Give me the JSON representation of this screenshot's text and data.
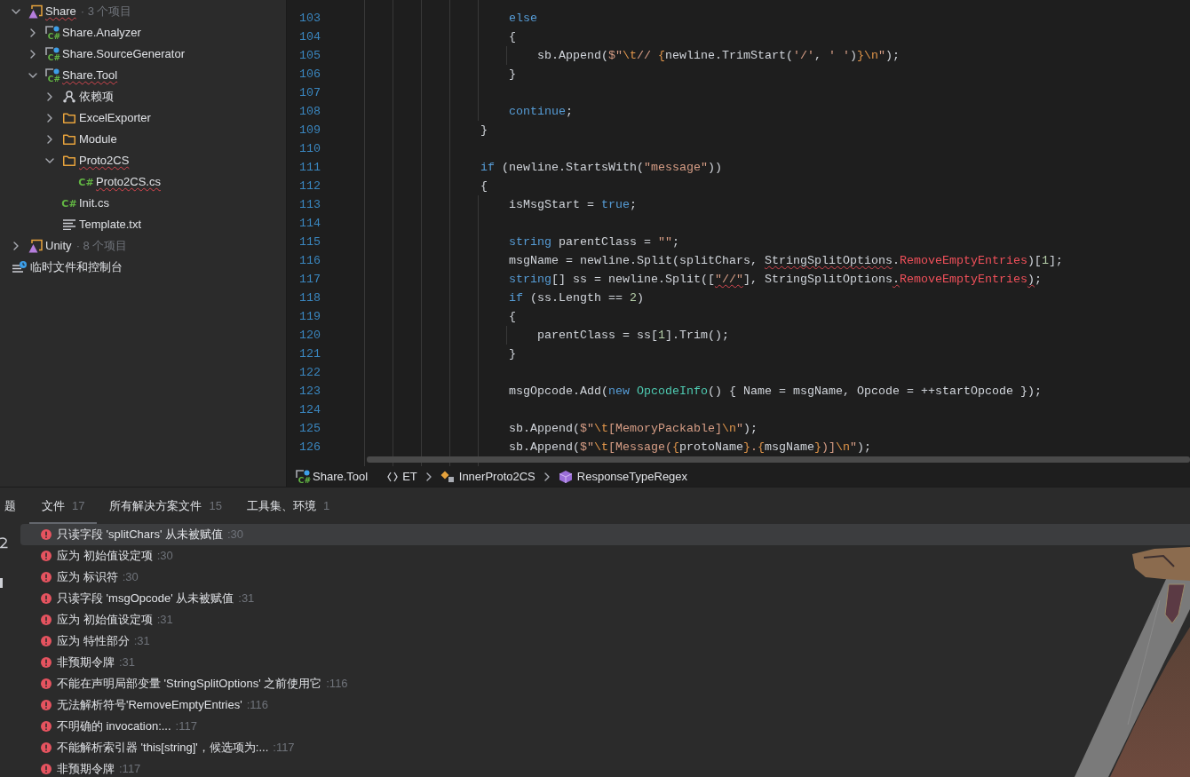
{
  "project_tree": {
    "items": [
      {
        "kind": "solution",
        "label": "Share",
        "suffix": "· 3 个项目",
        "error": true,
        "expanded": true,
        "children": [
          {
            "kind": "csproj",
            "icon_text": "C#",
            "label": "Share.Analyzer",
            "error": false,
            "expanded": false
          },
          {
            "kind": "csproj",
            "icon_text": "C#",
            "label": "Share.SourceGenerator",
            "error": false,
            "expanded": false
          },
          {
            "kind": "csproj",
            "icon_text": "C#",
            "label": "Share.Tool",
            "error": true,
            "expanded": true,
            "children": [
              {
                "kind": "dependencies",
                "label": "依赖项",
                "error": false,
                "expanded": false
              },
              {
                "kind": "folder",
                "label": "ExcelExporter",
                "error": false,
                "expanded": false
              },
              {
                "kind": "folder",
                "label": "Module",
                "error": false,
                "expanded": false
              },
              {
                "kind": "folder",
                "label": "Proto2CS",
                "error": true,
                "expanded": true,
                "children": [
                  {
                    "kind": "csfile",
                    "icon_text": "C#",
                    "label": "Proto2CS.cs",
                    "error": true
                  }
                ]
              },
              {
                "kind": "csfile",
                "icon_text": "C#",
                "label": "Init.cs",
                "error": false
              },
              {
                "kind": "textfile",
                "label": "Template.txt",
                "error": false
              }
            ]
          }
        ]
      },
      {
        "kind": "solution",
        "label": "Unity",
        "suffix": "· 8 个项目",
        "error": false,
        "expanded": false
      },
      {
        "kind": "scratches",
        "label": "临时文件和控制台",
        "error": false
      }
    ]
  },
  "editor": {
    "lines": [
      {
        "number": "103",
        "tokens": [
          {
            "kind": "keyword",
            "text": "                    else",
            "error": false
          }
        ]
      },
      {
        "number": "104",
        "tokens": [
          {
            "kind": "plain",
            "text": "                    {",
            "error": false
          }
        ]
      },
      {
        "number": "105",
        "tokens": [
          {
            "kind": "plain",
            "text": "                        sb.Append(",
            "error": false
          },
          {
            "kind": "string",
            "text": "$\"",
            "error": false
          },
          {
            "kind": "escape",
            "text": "\\t",
            "error": false
          },
          {
            "kind": "string",
            "text": "// ",
            "error": false
          },
          {
            "kind": "escape",
            "text": "{",
            "error": false
          },
          {
            "kind": "plain",
            "text": "newline.TrimStart(",
            "error": false
          },
          {
            "kind": "string",
            "text": "'/'",
            "error": false
          },
          {
            "kind": "plain",
            "text": ", ",
            "error": false
          },
          {
            "kind": "string",
            "text": "' '",
            "error": false
          },
          {
            "kind": "plain",
            "text": ")",
            "error": false
          },
          {
            "kind": "escape",
            "text": "}",
            "error": false
          },
          {
            "kind": "escape",
            "text": "\\n",
            "error": false
          },
          {
            "kind": "string",
            "text": "\"",
            "error": false
          },
          {
            "kind": "plain",
            "text": ");",
            "error": false
          }
        ]
      },
      {
        "number": "106",
        "tokens": [
          {
            "kind": "plain",
            "text": "                    }",
            "error": false
          }
        ]
      },
      {
        "number": "107"
      },
      {
        "number": "108",
        "tokens": [
          {
            "kind": "keyword",
            "text": "                    continue",
            "error": false
          },
          {
            "kind": "plain",
            "text": ";",
            "error": false
          }
        ]
      },
      {
        "number": "109",
        "tokens": [
          {
            "kind": "plain",
            "text": "                }",
            "error": false
          }
        ]
      },
      {
        "number": "110"
      },
      {
        "number": "111",
        "tokens": [
          {
            "kind": "keyword",
            "text": "                if",
            "error": false
          },
          {
            "kind": "plain",
            "text": " (newline.StartsWith(",
            "error": false
          },
          {
            "kind": "string",
            "text": "\"message\"",
            "error": false
          },
          {
            "kind": "plain",
            "text": "))",
            "error": false
          }
        ]
      },
      {
        "number": "112",
        "tokens": [
          {
            "kind": "plain",
            "text": "                {",
            "error": false
          }
        ]
      },
      {
        "number": "113",
        "tokens": [
          {
            "kind": "plain",
            "text": "                    isMsgStart = ",
            "error": false
          },
          {
            "kind": "keyword",
            "text": "true",
            "error": false
          },
          {
            "kind": "plain",
            "text": ";",
            "error": false
          }
        ]
      },
      {
        "number": "114"
      },
      {
        "number": "115",
        "tokens": [
          {
            "kind": "keyword",
            "text": "                    string",
            "error": false
          },
          {
            "kind": "plain",
            "text": " parentClass = ",
            "error": false
          },
          {
            "kind": "string",
            "text": "\"\"",
            "error": false
          },
          {
            "kind": "plain",
            "text": ";",
            "error": false
          }
        ]
      },
      {
        "number": "116",
        "tokens": [
          {
            "kind": "plain",
            "text": "                    msgName = newline.Split(splitChars, ",
            "error": false
          },
          {
            "kind": "plain",
            "text": "StringSplitOptions",
            "error": true
          },
          {
            "kind": "plain",
            "text": ".",
            "error": false
          },
          {
            "kind": "unresolved",
            "text": "RemoveEmptyEntries",
            "error": false
          },
          {
            "kind": "plain",
            "text": ")[",
            "error": false
          },
          {
            "kind": "number",
            "text": "1",
            "error": false
          },
          {
            "kind": "plain",
            "text": "];",
            "error": false
          }
        ]
      },
      {
        "number": "117",
        "tokens": [
          {
            "kind": "keyword",
            "text": "                    string",
            "error": false
          },
          {
            "kind": "plain",
            "text": "[] ss = newline.Split([",
            "error": false
          },
          {
            "kind": "string",
            "text": "\"//\"",
            "error": true
          },
          {
            "kind": "plain",
            "text": "], StringSplitOptions",
            "error": false
          },
          {
            "kind": "plain",
            "text": ".",
            "error": true
          },
          {
            "kind": "unresolved",
            "text": "RemoveEmptyEntries",
            "error": false
          },
          {
            "kind": "plain",
            "text": ")",
            "error": true
          },
          {
            "kind": "plain",
            "text": ";",
            "error": false
          }
        ]
      },
      {
        "number": "118",
        "tokens": [
          {
            "kind": "keyword",
            "text": "                    if",
            "error": false
          },
          {
            "kind": "plain",
            "text": " (ss.Length == ",
            "error": false
          },
          {
            "kind": "number",
            "text": "2",
            "error": false
          },
          {
            "kind": "plain",
            "text": ")",
            "error": false
          }
        ]
      },
      {
        "number": "119",
        "tokens": [
          {
            "kind": "plain",
            "text": "                    {",
            "error": false
          }
        ]
      },
      {
        "number": "120",
        "tokens": [
          {
            "kind": "plain",
            "text": "                        parentClass = ss[",
            "error": false
          },
          {
            "kind": "number",
            "text": "1",
            "error": false
          },
          {
            "kind": "plain",
            "text": "].Trim();",
            "error": false
          }
        ]
      },
      {
        "number": "121",
        "tokens": [
          {
            "kind": "plain",
            "text": "                    }",
            "error": false
          }
        ]
      },
      {
        "number": "122"
      },
      {
        "number": "123",
        "tokens": [
          {
            "kind": "plain",
            "text": "                    msgOpcode.Add(",
            "error": false
          },
          {
            "kind": "keyword",
            "text": "new",
            "error": false
          },
          {
            "kind": "type",
            "text": " OpcodeInfo",
            "error": false
          },
          {
            "kind": "plain",
            "text": "() { Name = msgName, Opcode = ++startOpcode });",
            "error": false
          }
        ]
      },
      {
        "number": "124"
      },
      {
        "number": "125",
        "tokens": [
          {
            "kind": "plain",
            "text": "                    sb.Append(",
            "error": false
          },
          {
            "kind": "string",
            "text": "$\"",
            "error": false
          },
          {
            "kind": "escape",
            "text": "\\t",
            "error": false
          },
          {
            "kind": "string",
            "text": "[MemoryPackable]",
            "error": false
          },
          {
            "kind": "escape",
            "text": "\\n",
            "error": false
          },
          {
            "kind": "string",
            "text": "\"",
            "error": false
          },
          {
            "kind": "plain",
            "text": ");",
            "error": false
          }
        ]
      },
      {
        "number": "126",
        "tokens": [
          {
            "kind": "plain",
            "text": "                    sb.Append(",
            "error": false
          },
          {
            "kind": "string",
            "text": "$\"",
            "error": false
          },
          {
            "kind": "escape",
            "text": "\\t",
            "error": false
          },
          {
            "kind": "string",
            "text": "[Message(",
            "error": false
          },
          {
            "kind": "escape",
            "text": "{",
            "error": false
          },
          {
            "kind": "plain",
            "text": "protoName",
            "error": false
          },
          {
            "kind": "escape",
            "text": "}",
            "error": false
          },
          {
            "kind": "string",
            "text": ".",
            "error": false
          },
          {
            "kind": "escape",
            "text": "{",
            "error": false
          },
          {
            "kind": "plain",
            "text": "msgName",
            "error": false
          },
          {
            "kind": "escape",
            "text": "}",
            "error": false
          },
          {
            "kind": "string",
            "text": ")]",
            "error": false
          },
          {
            "kind": "escape",
            "text": "\\n",
            "error": false
          },
          {
            "kind": "string",
            "text": "\"",
            "error": false
          },
          {
            "kind": "plain",
            "text": ");",
            "error": false
          }
        ]
      }
    ]
  },
  "breadcrumb": {
    "project": {
      "icon_text": "C#",
      "label": "Share.Tool"
    },
    "path": [
      {
        "kind": "namespace",
        "label": "ET"
      },
      {
        "kind": "class",
        "label": "InnerProto2CS"
      },
      {
        "kind": "member",
        "label": "ResponseTypeRegex"
      }
    ]
  },
  "problems_panel": {
    "title": "题",
    "tabs": [
      {
        "label": "文件",
        "count": "17",
        "selected": true
      },
      {
        "label": "所有解决方案文件",
        "count": "15",
        "selected": false
      },
      {
        "label": "工具集、环境",
        "count": "1",
        "selected": false
      }
    ],
    "items": [
      {
        "message": "只读字段 'splitChars' 从未被赋值",
        "location": ":30",
        "selected": true
      },
      {
        "message": "应为 初始值设定项",
        "location": ":30",
        "selected": false
      },
      {
        "message": "应为 标识符",
        "location": ":30",
        "selected": false
      },
      {
        "message": "只读字段 'msgOpcode' 从未被赋值",
        "location": ":31",
        "selected": false
      },
      {
        "message": "应为 初始值设定项",
        "location": ":31",
        "selected": false
      },
      {
        "message": "应为 特性部分",
        "location": ":31",
        "selected": false
      },
      {
        "message": "非预期令牌",
        "location": ":31",
        "selected": false
      },
      {
        "message": "不能在声明局部变量 'StringSplitOptions' 之前使用它",
        "location": ":116",
        "selected": false
      },
      {
        "message": "无法解析符号'RemoveEmptyEntries'",
        "location": ":116",
        "selected": false
      },
      {
        "message": "不明确的 invocation:...",
        "location": ":117",
        "selected": false
      },
      {
        "message": "不能解析索引器 'this[string]'，候选项为:...",
        "location": ":117",
        "selected": false
      },
      {
        "message": "非预期令牌",
        "location": ":117",
        "selected": false
      }
    ]
  }
}
